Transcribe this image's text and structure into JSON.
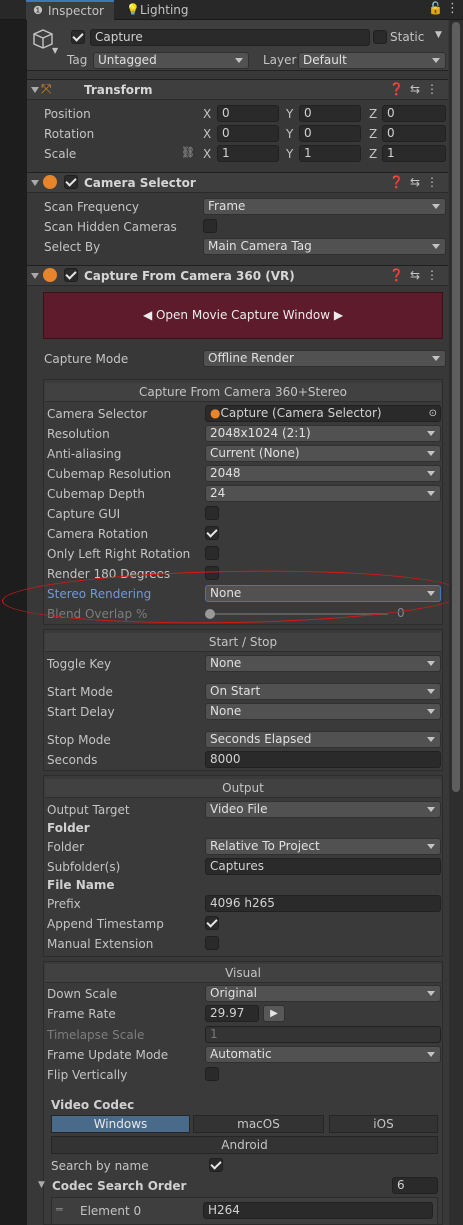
{
  "tabs": {
    "inspector": "Inspector",
    "lighting": "Lighting"
  },
  "object": {
    "name": "Capture",
    "static_label": "Static",
    "tag_label": "Tag",
    "tag_value": "Untagged",
    "layer_label": "Layer",
    "layer_value": "Default"
  },
  "transform": {
    "title": "Transform",
    "position_label": "Position",
    "rotation_label": "Rotation",
    "scale_label": "Scale",
    "axis_x": "X",
    "axis_y": "Y",
    "axis_z": "Z",
    "position": {
      "x": "0",
      "y": "0",
      "z": "0"
    },
    "rotation": {
      "x": "0",
      "y": "0",
      "z": "0"
    },
    "scale": {
      "x": "1",
      "y": "1",
      "z": "1"
    }
  },
  "camera_selector": {
    "title": "Camera Selector",
    "scan_frequency_label": "Scan Frequency",
    "scan_frequency_value": "Frame",
    "scan_hidden_label": "Scan Hidden Cameras",
    "select_by_label": "Select By",
    "select_by_value": "Main Camera Tag"
  },
  "capture360": {
    "title": "Capture From Camera 360 (VR)",
    "open_window_button": "◀ Open Movie Capture Window ▶",
    "capture_mode_label": "Capture Mode",
    "capture_mode_value": "Offline Render",
    "section_title": "Capture From Camera 360+Stereo",
    "camera_selector_label": "Camera Selector",
    "camera_selector_value": "Capture (Camera Selector)",
    "resolution_label": "Resolution",
    "resolution_value": "2048x1024 (2:1)",
    "antialiasing_label": "Anti-aliasing",
    "antialiasing_value": "Current (None)",
    "cubemap_res_label": "Cubemap Resolution",
    "cubemap_res_value": "2048",
    "cubemap_depth_label": "Cubemap Depth",
    "cubemap_depth_value": "24",
    "capture_gui_label": "Capture GUI",
    "camera_rotation_label": "Camera Rotation",
    "only_lr_label": "Only Left Right Rotation",
    "render180_label": "Render 180 Degrees",
    "stereo_label": "Stereo Rendering",
    "stereo_value": "None",
    "blend_label": "Blend Overlap %",
    "blend_value": "0"
  },
  "start_stop": {
    "section_title": "Start / Stop",
    "toggle_key_label": "Toggle Key",
    "toggle_key_value": "None",
    "start_mode_label": "Start Mode",
    "start_mode_value": "On Start",
    "start_delay_label": "Start Delay",
    "start_delay_value": "None",
    "stop_mode_label": "Stop Mode",
    "stop_mode_value": "Seconds Elapsed",
    "seconds_label": "Seconds",
    "seconds_value": "8000"
  },
  "output": {
    "section_title": "Output",
    "target_label": "Output Target",
    "target_value": "Video File",
    "folder_heading": "Folder",
    "folder_label": "Folder",
    "folder_value": "Relative To Project",
    "subfolder_label": "Subfolder(s)",
    "subfolder_value": "Captures",
    "filename_heading": "File Name",
    "prefix_label": "Prefix",
    "prefix_value": "4096 h265",
    "append_ts_label": "Append Timestamp",
    "manual_ext_label": "Manual Extension"
  },
  "visual": {
    "section_title": "Visual",
    "downscale_label": "Down Scale",
    "downscale_value": "Original",
    "framerate_label": "Frame Rate",
    "framerate_value": "29.97",
    "timelapse_label": "Timelapse Scale",
    "timelapse_value": "1",
    "frame_update_label": "Frame Update Mode",
    "frame_update_value": "Automatic",
    "flip_label": "Flip Vertically"
  },
  "codec": {
    "heading": "Video Codec",
    "tab_windows": "Windows",
    "tab_macos": "macOS",
    "tab_ios": "iOS",
    "tab_android": "Android",
    "search_by_name_label": "Search by name",
    "search_order_label": "Codec Search Order",
    "search_order_count": "6",
    "element0_label": "Element 0",
    "element0_value": "H264"
  }
}
